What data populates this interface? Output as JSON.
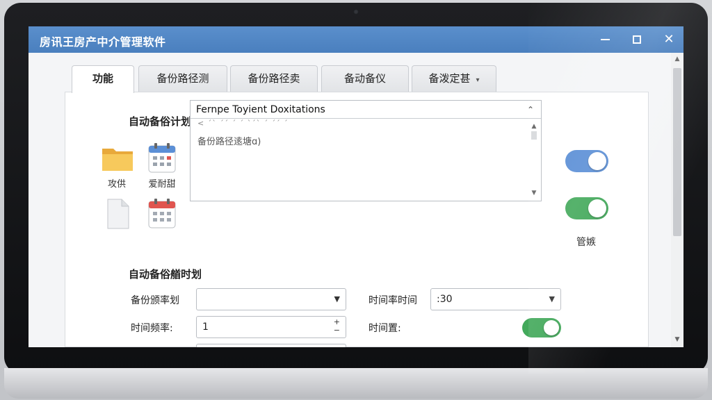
{
  "window": {
    "title": "房讯王房产中介管理软件",
    "controls": {
      "minimize": "",
      "maximize": "",
      "close": "✕"
    }
  },
  "tabs": [
    {
      "label": "功能",
      "active": true
    },
    {
      "label": "备份路径测"
    },
    {
      "label": "备份路径卖"
    },
    {
      "label": "备动备仪"
    },
    {
      "label": "备泼定甚",
      "dropdown_glyph": "▾"
    }
  ],
  "schedule": {
    "title": "自动备俗计划词",
    "icons": [
      {
        "icon": "folder-icon",
        "label": "攻供"
      },
      {
        "icon": "calendar-icon",
        "label": "爱耐甜"
      },
      {
        "icon": "document-icon",
        "label": ""
      },
      {
        "icon": "calendar-red-icon",
        "label": ""
      }
    ],
    "list": {
      "header": "Fernpe Toyient Doxitations",
      "up_glyph": "⌃",
      "ghost_text": "< ˊˋ ˊˊ ˊ ˊ ˋˊˋ ˊ ˊˊ ˊ",
      "item": "备份路径逺塘ɑ)"
    },
    "toggles": [
      {
        "state": "on",
        "color": "#5b8fd6"
      },
      {
        "state": "on",
        "color": "#43a95b",
        "label": "管嫉"
      }
    ]
  },
  "settings": {
    "title": "自动备俗艏时划",
    "rows": [
      {
        "label": "备份颁率划",
        "value": "",
        "control": "dropdown"
      },
      {
        "label": "时间频率:",
        "value": "1",
        "control": "spinner"
      },
      {
        "label": "时间率时间",
        "value": ":30",
        "control": "dropdown"
      },
      {
        "label": "时间置:",
        "toggle": "on"
      }
    ]
  },
  "colors": {
    "titlebar": "#4f86c6",
    "toggle_blue": "#5b8fd6",
    "toggle_green": "#43a95b"
  }
}
